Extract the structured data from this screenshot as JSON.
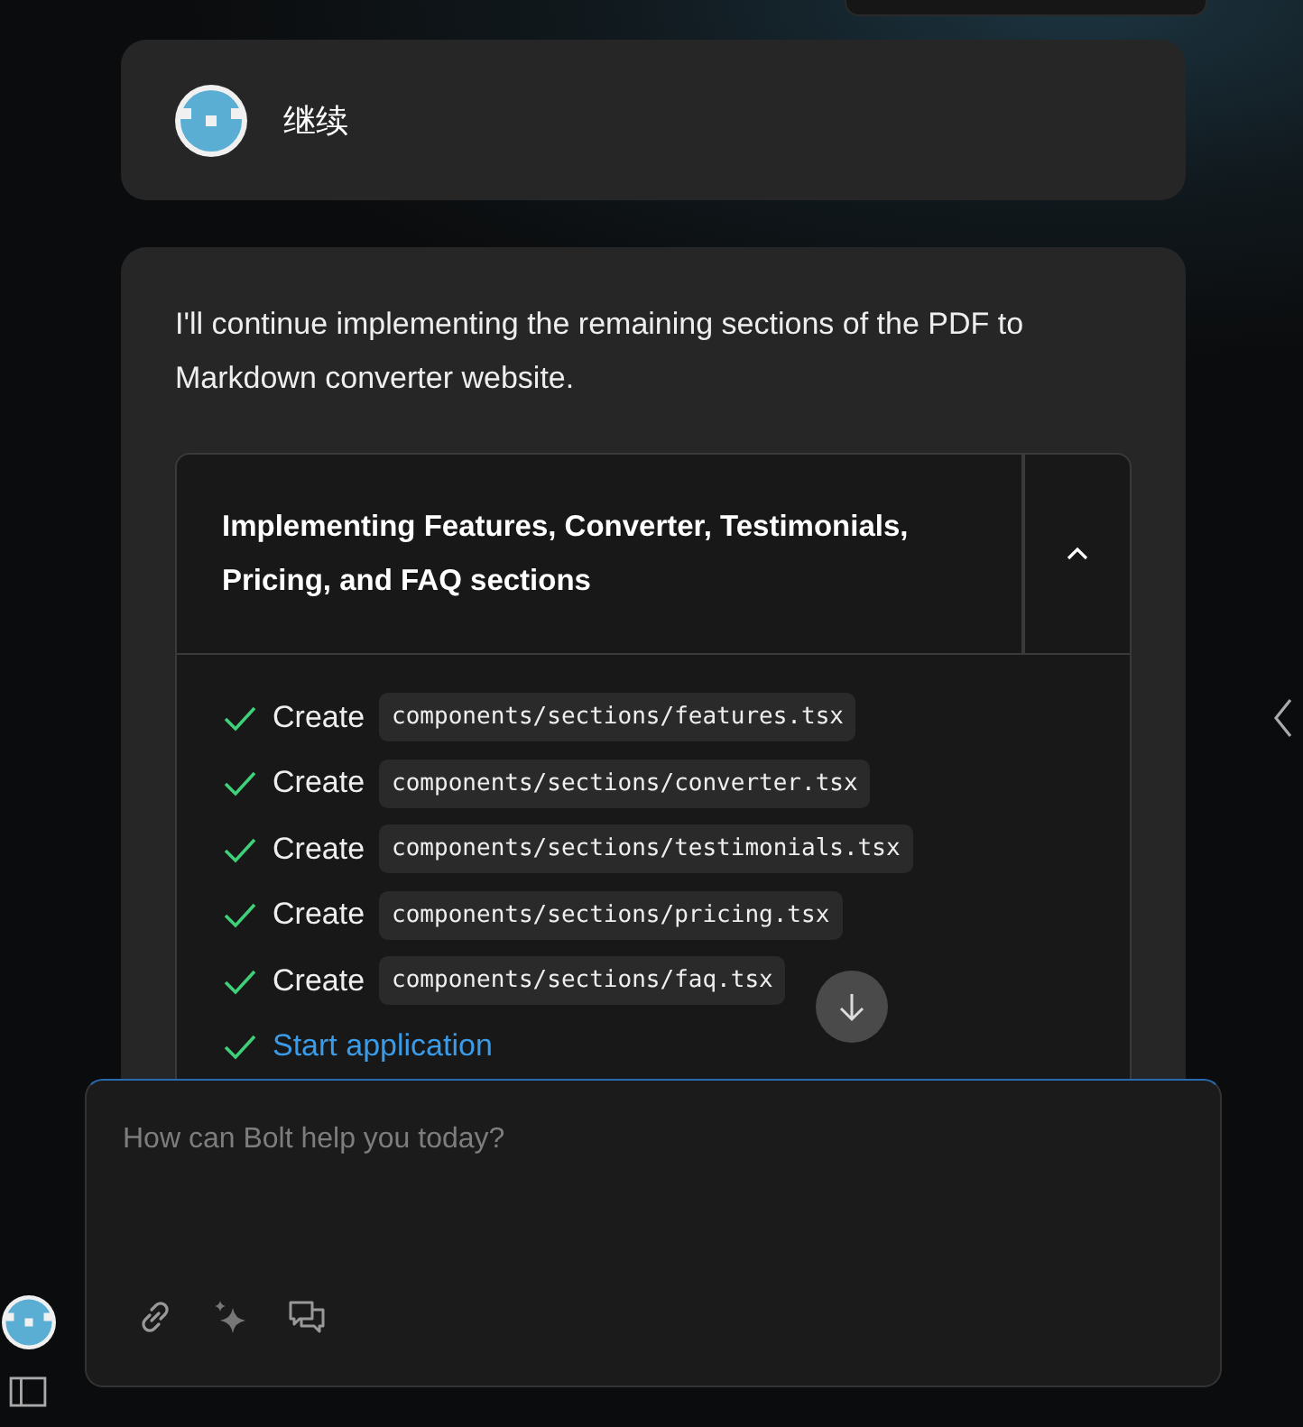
{
  "user_message": {
    "text": "继续"
  },
  "assistant_message": {
    "text": "I'll continue implementing the remaining sections of the PDF to Markdown converter website.",
    "action": {
      "title": "Implementing Features, Converter, Testimonials, Pricing, and FAQ sections",
      "expanded": true,
      "steps": [
        {
          "kind": "file",
          "verb": "Create",
          "path": "components/sections/features.tsx",
          "done": true
        },
        {
          "kind": "file",
          "verb": "Create",
          "path": "components/sections/converter.tsx",
          "done": true
        },
        {
          "kind": "file",
          "verb": "Create",
          "path": "components/sections/testimonials.tsx",
          "done": true
        },
        {
          "kind": "file",
          "verb": "Create",
          "path": "components/sections/pricing.tsx",
          "done": true
        },
        {
          "kind": "file",
          "verb": "Create",
          "path": "components/sections/faq.tsx",
          "done": true
        },
        {
          "kind": "command",
          "label": "Start application",
          "done": true
        }
      ]
    }
  },
  "prompt": {
    "placeholder": "How can Bolt help you today?"
  }
}
